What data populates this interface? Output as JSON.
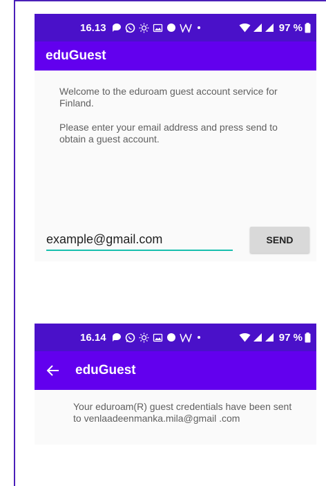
{
  "colors": {
    "status_bar": "#4a11c9",
    "app_bar": "#6200ee",
    "accent_underline": "#16bfad",
    "frame": "#4a1fb8"
  },
  "screen1": {
    "status_bar": {
      "time": "16.13",
      "icons": [
        "chat-bubble-icon",
        "whatsapp-icon",
        "sun-icon",
        "gallery-icon",
        "dot-icon",
        "w-icon",
        "small-dot-icon"
      ],
      "battery_text": "97 %"
    },
    "app_bar": {
      "title": "eduGuest"
    },
    "welcome_text": "Welcome to the eduroam guest account service for Finland.",
    "instructions_text": "Please enter your email address and press send to obtain a guest account.",
    "email_field": {
      "value": "example@gmail.com"
    },
    "send_button": {
      "label": "SEND"
    }
  },
  "screen2": {
    "status_bar": {
      "time": "16.14",
      "battery_text": "97 %"
    },
    "app_bar": {
      "title": "eduGuest"
    },
    "confirmation_text": "Your eduroam(R) guest credentials have been sent to venlaadeenmanka.mila@gmail .com"
  }
}
